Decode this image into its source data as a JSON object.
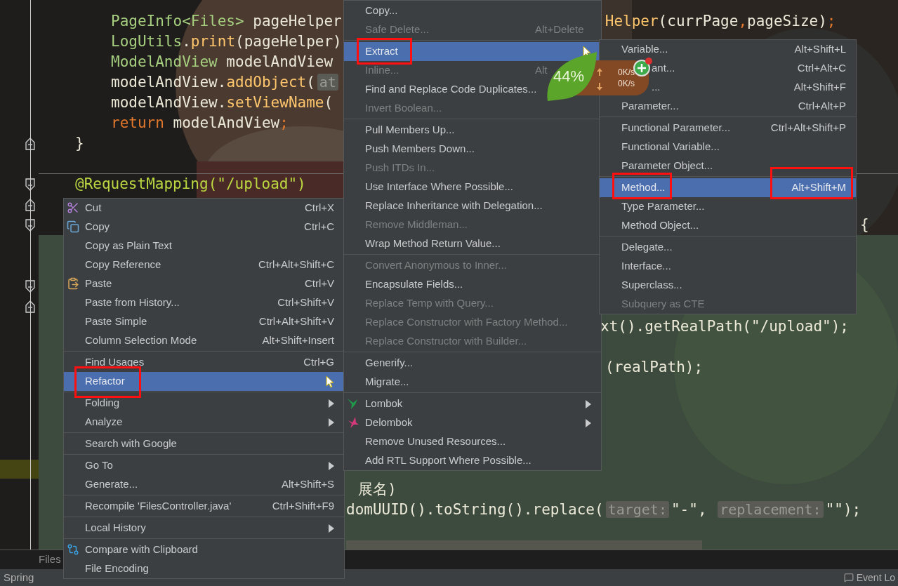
{
  "code_lines": [
    {
      "segments": [
        {
          "kind": "type",
          "text": "PageInfo<Files>"
        },
        {
          "kind": "plain",
          "text": " pageHelper"
        }
      ]
    },
    {
      "segments": [
        {
          "kind": "method",
          "text": "Helper"
        },
        {
          "kind": "plain",
          "text": "(currPage"
        },
        {
          "kind": "keyword",
          "text": ","
        },
        {
          "kind": "plain",
          "text": "pageSize)"
        },
        {
          "kind": "keyword",
          "text": ";"
        }
      ]
    },
    {
      "segments": [
        {
          "kind": "type",
          "text": "LogUtils"
        },
        {
          "kind": "plain",
          "text": "."
        },
        {
          "kind": "method",
          "text": "print"
        },
        {
          "kind": "plain",
          "text": "(pageHelper)"
        }
      ]
    },
    {
      "segments": [
        {
          "kind": "type",
          "text": "ModelAndView"
        },
        {
          "kind": "plain",
          "text": " modelAndView"
        }
      ]
    },
    {
      "segments": [
        {
          "kind": "plain",
          "text": "modelAndView."
        },
        {
          "kind": "method",
          "text": "addObject"
        },
        {
          "kind": "plain",
          "text": "("
        },
        {
          "kind": "hint",
          "text": "at"
        }
      ]
    },
    {
      "segments": [
        {
          "kind": "plain",
          "text": "modelAndView."
        },
        {
          "kind": "method",
          "text": "setViewName"
        },
        {
          "kind": "plain",
          "text": "("
        }
      ]
    },
    {
      "segments": [
        {
          "kind": "keyword",
          "text": "return"
        },
        {
          "kind": "plain",
          "text": " modelAndView"
        },
        {
          "kind": "keyword",
          "text": ";"
        }
      ]
    },
    {
      "segments": [
        {
          "kind": "plain",
          "text": "}"
        }
      ]
    },
    {
      "segments": [
        {
          "kind": "annotation",
          "text": "@RequestMapping(\"/upload\")"
        }
      ]
    },
    {
      "segments": [
        {
          "kind": "plain",
          "text": "{"
        }
      ]
    },
    {
      "segments": [
        {
          "kind": "plain",
          "text": "xt().getRealPath(\"/upload\");"
        }
      ]
    },
    {
      "segments": [
        {
          "kind": "plain",
          "text": "(realPath);"
        }
      ]
    },
    {
      "segments": [
        {
          "kind": "plain",
          "text": "展名)"
        }
      ]
    },
    {
      "segments": [
        {
          "kind": "plain",
          "text": "domUUID().toString().replace("
        },
        {
          "kind": "hint",
          "text": "target:"
        },
        {
          "kind": "plain",
          "text": "\"-\", "
        },
        {
          "kind": "hint",
          "text": "replacement:"
        },
        {
          "kind": "plain",
          "text": "\"\");"
        }
      ]
    }
  ],
  "context_menu": {
    "items": [
      {
        "kind": "item",
        "label": "Cut",
        "shortcut": "Ctrl+X",
        "disabled": false,
        "selected": false,
        "annotated": false,
        "has_submenu": false
      },
      {
        "kind": "item",
        "label": "Copy",
        "shortcut": "Ctrl+C",
        "disabled": false,
        "selected": false,
        "annotated": false,
        "has_submenu": false
      },
      {
        "kind": "item",
        "label": "Copy as Plain Text",
        "disabled": false,
        "selected": false,
        "annotated": false,
        "has_submenu": false
      },
      {
        "kind": "item",
        "label": "Copy Reference",
        "shortcut": "Ctrl+Alt+Shift+C",
        "disabled": false,
        "selected": false,
        "annotated": false,
        "has_submenu": false
      },
      {
        "kind": "item",
        "label": "Paste",
        "shortcut": "Ctrl+V",
        "disabled": false,
        "selected": false,
        "annotated": false,
        "has_submenu": false
      },
      {
        "kind": "item",
        "label": "Paste from History...",
        "shortcut": "Ctrl+Shift+V",
        "disabled": false,
        "selected": false,
        "annotated": false,
        "has_submenu": false
      },
      {
        "kind": "item",
        "label": "Paste Simple",
        "shortcut": "Ctrl+Alt+Shift+V",
        "disabled": false,
        "selected": false,
        "annotated": false,
        "has_submenu": false
      },
      {
        "kind": "item",
        "label": "Column Selection Mode",
        "shortcut": "Alt+Shift+Insert",
        "disabled": false,
        "selected": false,
        "annotated": false,
        "has_submenu": false
      },
      {
        "kind": "separator"
      },
      {
        "kind": "item",
        "label": "Find Usages",
        "shortcut": "Ctrl+G",
        "disabled": false,
        "selected": false,
        "annotated": false,
        "has_submenu": false
      },
      {
        "kind": "item",
        "label": "Refactor",
        "disabled": false,
        "selected": true,
        "annotated": true,
        "has_submenu": true
      },
      {
        "kind": "separator"
      },
      {
        "kind": "item",
        "label": "Folding",
        "disabled": false,
        "selected": false,
        "annotated": false,
        "has_submenu": true
      },
      {
        "kind": "item",
        "label": "Analyze",
        "disabled": false,
        "selected": false,
        "annotated": false,
        "has_submenu": true
      },
      {
        "kind": "separator"
      },
      {
        "kind": "item",
        "label": "Search with Google",
        "disabled": false,
        "selected": false,
        "annotated": false,
        "has_submenu": false
      },
      {
        "kind": "separator"
      },
      {
        "kind": "item",
        "label": "Go To",
        "disabled": false,
        "selected": false,
        "annotated": false,
        "has_submenu": true
      },
      {
        "kind": "item",
        "label": "Generate...",
        "shortcut": "Alt+Shift+S",
        "disabled": false,
        "selected": false,
        "annotated": false,
        "has_submenu": false
      },
      {
        "kind": "separator"
      },
      {
        "kind": "item",
        "label": "Recompile 'FilesController.java'",
        "shortcut": "Ctrl+Shift+F9",
        "disabled": false,
        "selected": false,
        "annotated": false,
        "has_submenu": false
      },
      {
        "kind": "separator"
      },
      {
        "kind": "item",
        "label": "Local History",
        "disabled": false,
        "selected": false,
        "annotated": false,
        "has_submenu": true
      },
      {
        "kind": "separator"
      },
      {
        "kind": "item",
        "label": "Compare with Clipboard",
        "disabled": false,
        "selected": false,
        "annotated": false,
        "has_submenu": false
      },
      {
        "kind": "item",
        "label": "File Encoding",
        "disabled": false,
        "selected": false,
        "annotated": false,
        "has_submenu": false
      }
    ]
  },
  "refactor_menu": {
    "items": [
      {
        "kind": "item",
        "label": "Copy...",
        "disabled": false,
        "selected": false,
        "annotated": false,
        "has_submenu": false
      },
      {
        "kind": "item",
        "label": "Safe Delete...",
        "shortcut": "Alt+Delete",
        "disabled": true,
        "selected": false,
        "annotated": false,
        "has_submenu": false
      },
      {
        "kind": "separator"
      },
      {
        "kind": "item",
        "label": "Extract",
        "disabled": false,
        "selected": true,
        "annotated": true,
        "has_submenu": true
      },
      {
        "kind": "item",
        "label": "Inline...",
        "shortcut": "Alt",
        "disabled": true,
        "selected": false,
        "annotated": false,
        "has_submenu": false
      },
      {
        "kind": "item",
        "label": "Find and Replace Code Duplicates...",
        "disabled": false,
        "selected": false,
        "annotated": false,
        "has_submenu": false
      },
      {
        "kind": "item",
        "label": "Invert Boolean...",
        "disabled": true,
        "selected": false,
        "annotated": false,
        "has_submenu": false
      },
      {
        "kind": "separator"
      },
      {
        "kind": "item",
        "label": "Pull Members Up...",
        "disabled": false,
        "selected": false,
        "annotated": false,
        "has_submenu": false
      },
      {
        "kind": "item",
        "label": "Push Members Down...",
        "disabled": false,
        "selected": false,
        "annotated": false,
        "has_submenu": false
      },
      {
        "kind": "item",
        "label": "Push ITDs In...",
        "disabled": true,
        "selected": false,
        "annotated": false,
        "has_submenu": false
      },
      {
        "kind": "item",
        "label": "Use Interface Where Possible...",
        "disabled": false,
        "selected": false,
        "annotated": false,
        "has_submenu": false
      },
      {
        "kind": "item",
        "label": "Replace Inheritance with Delegation...",
        "disabled": false,
        "selected": false,
        "annotated": false,
        "has_submenu": false
      },
      {
        "kind": "item",
        "label": "Remove Middleman...",
        "disabled": true,
        "selected": false,
        "annotated": false,
        "has_submenu": false
      },
      {
        "kind": "item",
        "label": "Wrap Method Return Value...",
        "disabled": false,
        "selected": false,
        "annotated": false,
        "has_submenu": false
      },
      {
        "kind": "separator"
      },
      {
        "kind": "item",
        "label": "Convert Anonymous to Inner...",
        "disabled": true,
        "selected": false,
        "annotated": false,
        "has_submenu": false
      },
      {
        "kind": "item",
        "label": "Encapsulate Fields...",
        "disabled": false,
        "selected": false,
        "annotated": false,
        "has_submenu": false
      },
      {
        "kind": "item",
        "label": "Replace Temp with Query...",
        "disabled": true,
        "selected": false,
        "annotated": false,
        "has_submenu": false
      },
      {
        "kind": "item",
        "label": "Replace Constructor with Factory Method...",
        "disabled": true,
        "selected": false,
        "annotated": false,
        "has_submenu": false
      },
      {
        "kind": "item",
        "label": "Replace Constructor with Builder...",
        "disabled": true,
        "selected": false,
        "annotated": false,
        "has_submenu": false
      },
      {
        "kind": "separator"
      },
      {
        "kind": "item",
        "label": "Generify...",
        "disabled": false,
        "selected": false,
        "annotated": false,
        "has_submenu": false
      },
      {
        "kind": "item",
        "label": "Migrate...",
        "disabled": false,
        "selected": false,
        "annotated": false,
        "has_submenu": false
      },
      {
        "kind": "separator"
      },
      {
        "kind": "item",
        "label": "Lombok",
        "disabled": false,
        "selected": false,
        "annotated": false,
        "has_submenu": true
      },
      {
        "kind": "item",
        "label": "Delombok",
        "disabled": false,
        "selected": false,
        "annotated": false,
        "has_submenu": true
      },
      {
        "kind": "item",
        "label": "Remove Unused Resources...",
        "disabled": false,
        "selected": false,
        "annotated": false,
        "has_submenu": false
      },
      {
        "kind": "item",
        "label": "Add RTL Support Where Possible...",
        "disabled": false,
        "selected": false,
        "annotated": false,
        "has_submenu": false
      }
    ]
  },
  "extract_menu": {
    "items": [
      {
        "kind": "item",
        "label": "Variable...",
        "shortcut": "Alt+Shift+L",
        "covered": false,
        "disabled": false,
        "selected": false,
        "annotated": false,
        "has_submenu": false
      },
      {
        "kind": "item",
        "label": "ant...",
        "shortcut": "Ctrl+Alt+C",
        "covered": true,
        "disabled": false,
        "selected": false,
        "annotated": false,
        "has_submenu": false
      },
      {
        "kind": "item",
        "label": "...",
        "shortcut": "Alt+Shift+F",
        "covered": true,
        "disabled": false,
        "selected": false,
        "annotated": false,
        "has_submenu": false
      },
      {
        "kind": "item",
        "label": "Parameter...",
        "shortcut": "Ctrl+Alt+P",
        "covered": false,
        "disabled": false,
        "selected": false,
        "annotated": false,
        "has_submenu": false
      },
      {
        "kind": "separator"
      },
      {
        "kind": "item",
        "label": "Functional Parameter...",
        "shortcut": "Ctrl+Alt+Shift+P",
        "covered": false,
        "disabled": false,
        "selected": false,
        "annotated": false,
        "has_submenu": false
      },
      {
        "kind": "item",
        "label": "Functional Variable...",
        "covered": false,
        "disabled": false,
        "selected": false,
        "annotated": false,
        "has_submenu": false
      },
      {
        "kind": "item",
        "label": "Parameter Object...",
        "covered": false,
        "disabled": false,
        "selected": false,
        "annotated": false,
        "has_submenu": false
      },
      {
        "kind": "separator"
      },
      {
        "kind": "item",
        "label": "Method...",
        "shortcut": "Alt+Shift+M",
        "covered": false,
        "disabled": false,
        "selected": true,
        "annotated": true,
        "has_submenu": false
      },
      {
        "kind": "item",
        "label": "Type Parameter...",
        "covered": false,
        "disabled": false,
        "selected": false,
        "annotated": false,
        "has_submenu": false
      },
      {
        "kind": "item",
        "label": "Method Object...",
        "covered": false,
        "disabled": false,
        "selected": false,
        "annotated": false,
        "has_submenu": false
      },
      {
        "kind": "separator"
      },
      {
        "kind": "item",
        "label": "Delegate...",
        "covered": false,
        "disabled": false,
        "selected": false,
        "annotated": false,
        "has_submenu": false
      },
      {
        "kind": "item",
        "label": "Interface...",
        "covered": false,
        "disabled": false,
        "selected": false,
        "annotated": false,
        "has_submenu": false
      },
      {
        "kind": "item",
        "label": "Superclass...",
        "covered": false,
        "disabled": false,
        "selected": false,
        "annotated": false,
        "has_submenu": false
      },
      {
        "kind": "item",
        "label": "Subquery as CTE",
        "covered": false,
        "disabled": true,
        "selected": false,
        "annotated": false,
        "has_submenu": false
      }
    ]
  },
  "speed_widget": {
    "percent": "44%",
    "upload": "0K/s",
    "download": "0K/s"
  },
  "tool_window_bar": {
    "tab": "Files"
  },
  "status_bar": {
    "left": "Spring",
    "right": "Event Lo"
  }
}
